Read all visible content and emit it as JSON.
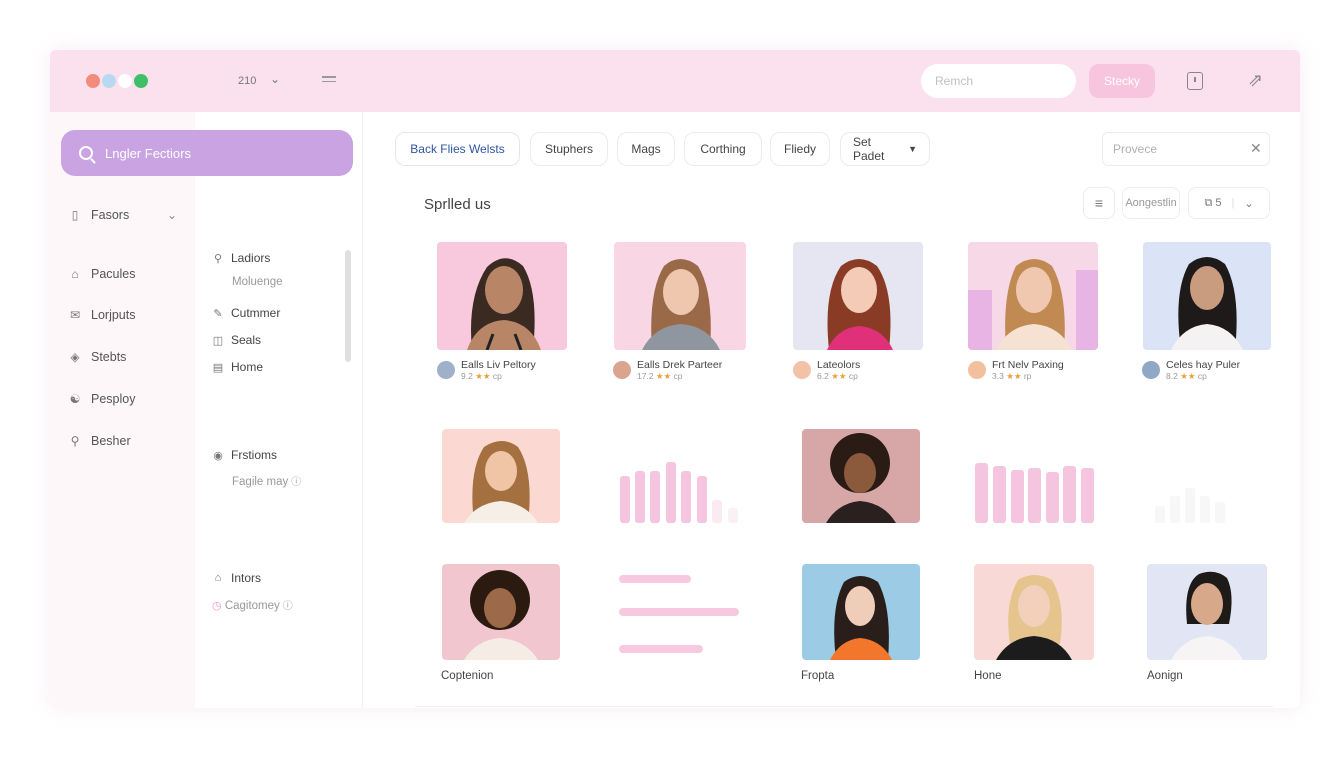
{
  "topbar": {
    "window_dots": [
      "#f28b7a",
      "#b9d9f2",
      "#ffffff",
      "#3fbf6a"
    ],
    "version": "210",
    "search_placeholder": "Remch",
    "action_label": "Stecky"
  },
  "sidebar": {
    "primary_button": "Lngler Fectiors",
    "items": [
      {
        "label": "Fasors",
        "icon": "document-icon"
      },
      {
        "label": "Pacules",
        "icon": "home-icon"
      },
      {
        "label": "Lorjputs",
        "icon": "mail-icon"
      },
      {
        "label": "Stebts",
        "icon": "tag-icon"
      },
      {
        "label": "Pesploy",
        "icon": "user-icon"
      },
      {
        "label": "Besher",
        "icon": "person-icon"
      }
    ]
  },
  "subnav": {
    "group1": [
      {
        "label": "Ladiors",
        "icon": "person-icon"
      },
      {
        "label": "Moluenge",
        "muted": true
      },
      {
        "label": "Cutmmer",
        "icon": "pen-icon"
      },
      {
        "label": "Seals",
        "icon": "database-icon"
      },
      {
        "label": "Home",
        "icon": "folder-icon"
      }
    ],
    "group2_title": "Frstioms",
    "group2_sub": "Fagile may",
    "group3_title": "Intors",
    "group3_sub": "Cagitomey"
  },
  "chips": [
    "Back Flies Welsts",
    "Stuphers",
    "Mags",
    "Corthing",
    "Fliedy",
    "Set Padet"
  ],
  "filter_placeholder": "Provece",
  "section_title": "Sprlled us",
  "toolbar": {
    "sort_label": "Aongestlin",
    "count_label": "5"
  },
  "cards": [
    {
      "name": "Ealls Liv Peltory",
      "rating": "9.2",
      "tail": "cp"
    },
    {
      "name": "Ealls Drek Parteer",
      "rating": "17.2",
      "tail": "cp"
    },
    {
      "name": "Lateolors",
      "rating": "6.2",
      "tail": "cp"
    },
    {
      "name": "Frt Nelv Paxing",
      "rating": "3.3",
      "tail": "rp"
    },
    {
      "name": "Celes hay Puler",
      "rating": "8.2",
      "tail": "cp"
    }
  ],
  "captions": [
    "Coptenion",
    "Fropta",
    "Hone",
    "Aonign"
  ],
  "colors": {
    "accent": "#c9a3e2",
    "topbar": "#fbe0ee",
    "link": "#2f55a0",
    "star": "#e9a13b"
  }
}
